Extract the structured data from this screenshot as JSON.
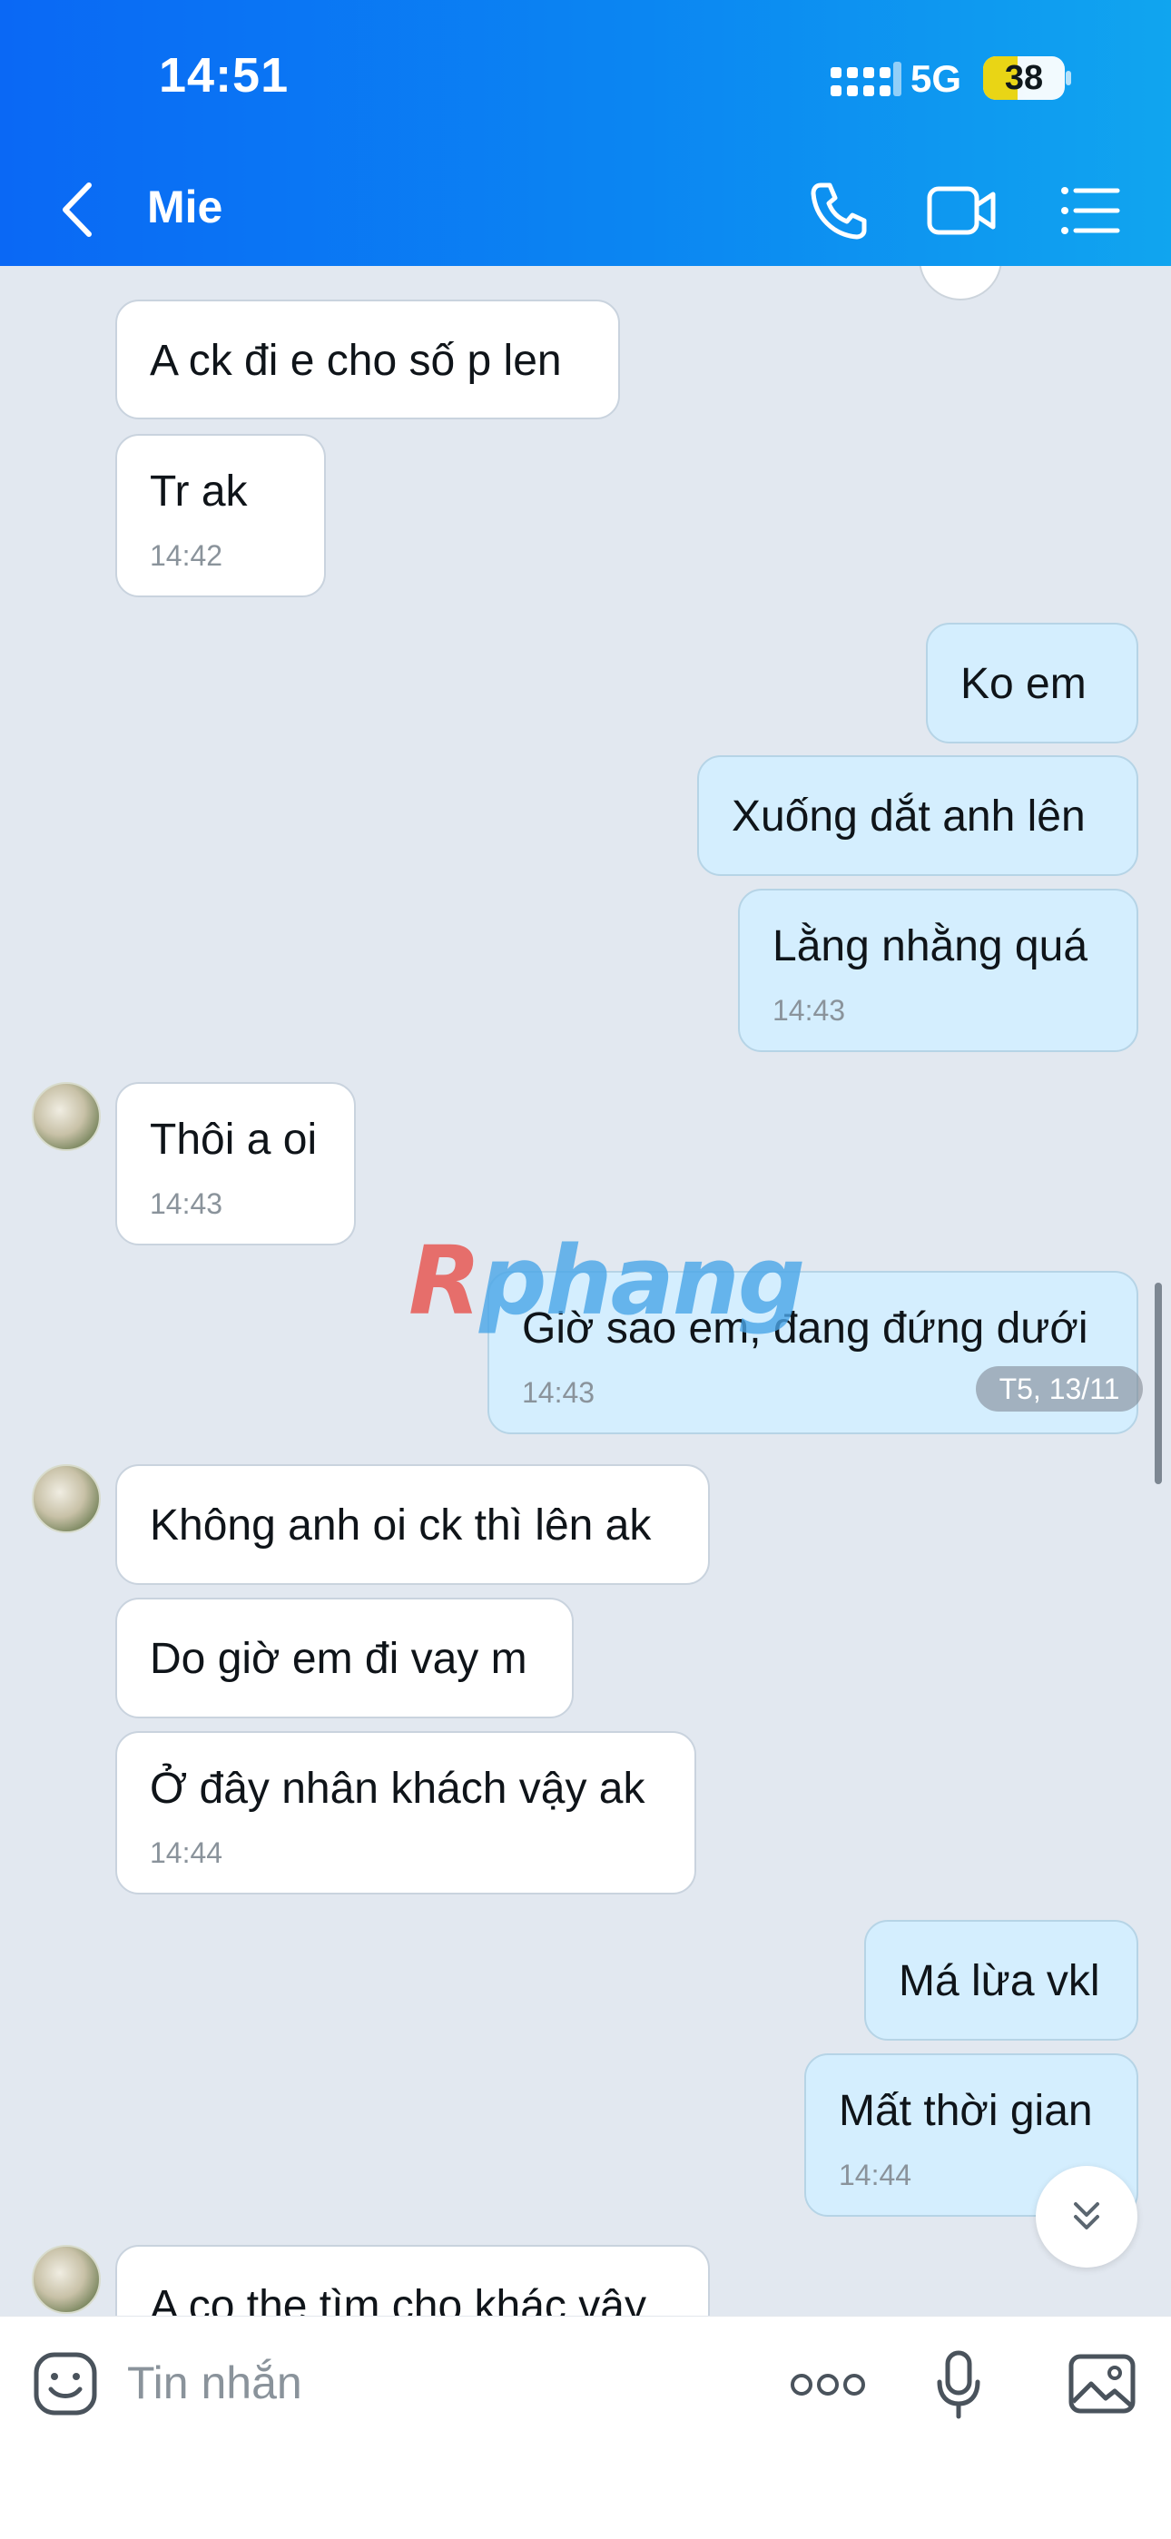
{
  "status_bar": {
    "time": "14:51",
    "network": "5G",
    "battery": "38"
  },
  "header": {
    "title": "Mie"
  },
  "messages": [
    {
      "text": "A ck đi e cho số p len"
    },
    {
      "text": "Tr ak",
      "time": "14:42"
    },
    {
      "text": "Ko em"
    },
    {
      "text": "Xuống dắt anh lên"
    },
    {
      "text": "Lằng nhằng quá",
      "time": "14:43"
    },
    {
      "text": "Thôi a oi",
      "time": "14:43"
    },
    {
      "text": "Giờ sao em, đang đứng dưới",
      "time": "14:43"
    },
    {
      "text": "Không anh oi ck thì lên ak"
    },
    {
      "text": "Do giờ em đi vay m"
    },
    {
      "text": "Ở đây nhân khách vậy ak",
      "time": "14:44"
    },
    {
      "text": "Má lừa vkl"
    },
    {
      "text": "Mất thời gian",
      "time": "14:44"
    },
    {
      "text": "A co the tìm cho khác vây"
    }
  ],
  "date_pill": "T5, 13/11",
  "watermark": {
    "r": "R",
    "rest": "phang"
  },
  "input": {
    "placeholder": "Tin nhắn"
  },
  "colors": {
    "header_start": "#0a68f5",
    "header_end": "#10a5ef",
    "outgoing_bubble": "#d4eefe",
    "incoming_bubble": "#ffffff",
    "chat_bg": "#e2e8f0"
  },
  "icons": [
    "back-chevron-icon",
    "phone-icon",
    "video-call-icon",
    "menu-list-icon",
    "sticker-icon",
    "more-icon",
    "microphone-icon",
    "image-icon",
    "chevron-down-double-icon"
  ]
}
